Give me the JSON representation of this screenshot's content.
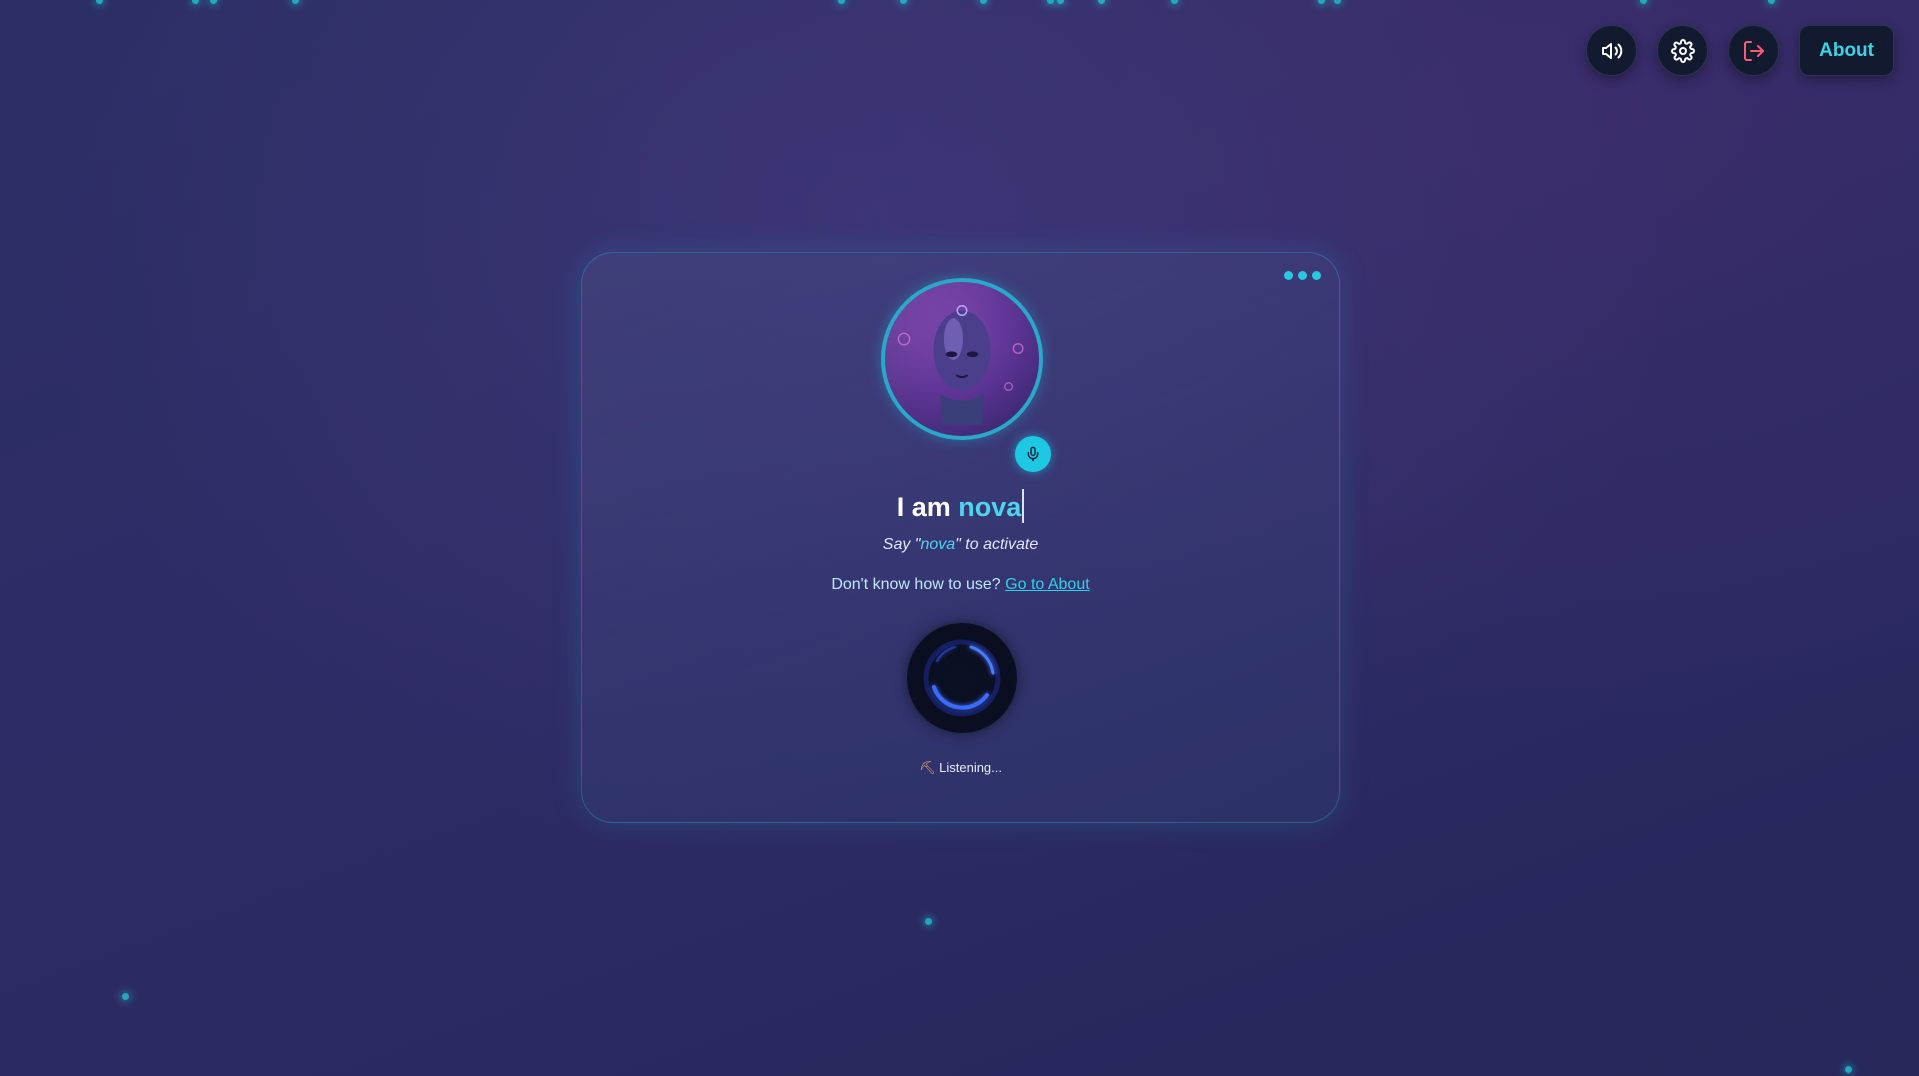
{
  "topbar": {
    "volume_icon": "volume-icon",
    "settings_icon": "gear-icon",
    "logout_icon": "logout-icon",
    "about_label": "About"
  },
  "card": {
    "menu_icon": "more-dots-icon",
    "avatar_icon": "robot-avatar",
    "mic_icon": "microphone-icon",
    "title_prefix": "I am ",
    "title_name": "nova",
    "subtitle_prefix": "Say \"",
    "subtitle_name": "nova",
    "subtitle_suffix": "\" to activate",
    "help_text": "Don't know how to use? ",
    "help_link": "Go to About",
    "orb_icon": "voice-orb",
    "status_icon": "pick-icon",
    "status_text": "Listening..."
  },
  "colors": {
    "accent": "#1ec8e3",
    "background": "#2c2f63",
    "logout": "#ff5a7a"
  }
}
